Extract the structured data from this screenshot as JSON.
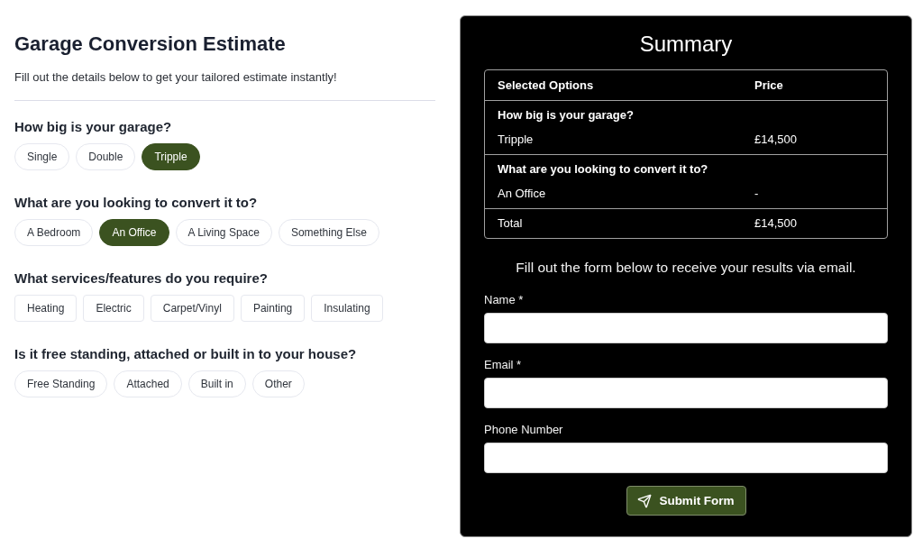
{
  "header": {
    "title": "Garage Conversion Estimate",
    "subtitle": "Fill out the details below to get your tailored estimate instantly!"
  },
  "questions": [
    {
      "title": "How big is your garage?",
      "kind": "pill",
      "options": [
        {
          "label": "Single",
          "selected": false
        },
        {
          "label": "Double",
          "selected": false
        },
        {
          "label": "Tripple",
          "selected": true
        }
      ]
    },
    {
      "title": "What are you looking to convert it to?",
      "kind": "pill",
      "options": [
        {
          "label": "A Bedroom",
          "selected": false
        },
        {
          "label": "An Office",
          "selected": true
        },
        {
          "label": "A Living Space",
          "selected": false
        },
        {
          "label": "Something Else",
          "selected": false
        }
      ]
    },
    {
      "title": "What services/features do you require?",
      "kind": "tile",
      "options": [
        {
          "label": "Heating",
          "selected": false
        },
        {
          "label": "Electric",
          "selected": false
        },
        {
          "label": "Carpet/Vinyl",
          "selected": false
        },
        {
          "label": "Painting",
          "selected": false
        },
        {
          "label": "Insulating",
          "selected": false
        }
      ]
    },
    {
      "title": "Is it free standing, attached or built in to your house?",
      "kind": "pill",
      "options": [
        {
          "label": "Free Standing",
          "selected": false
        },
        {
          "label": "Attached",
          "selected": false
        },
        {
          "label": "Built in",
          "selected": false
        },
        {
          "label": "Other",
          "selected": false
        }
      ]
    }
  ],
  "summary": {
    "title": "Summary",
    "columns": [
      "Selected Options",
      "Price"
    ],
    "rows": [
      {
        "question": "How big is your garage?",
        "answer": "Tripple",
        "price": "£14,500"
      },
      {
        "question": "What are you looking to convert it to?",
        "answer": "An Office",
        "price": "-"
      }
    ],
    "total": {
      "label": "Total",
      "price": "£14,500"
    }
  },
  "form": {
    "intro": "Fill out the form below to receive your results via email.",
    "fields": [
      {
        "label": "Name *"
      },
      {
        "label": "Email *"
      },
      {
        "label": "Phone Number"
      }
    ],
    "submit": "Submit Form"
  }
}
